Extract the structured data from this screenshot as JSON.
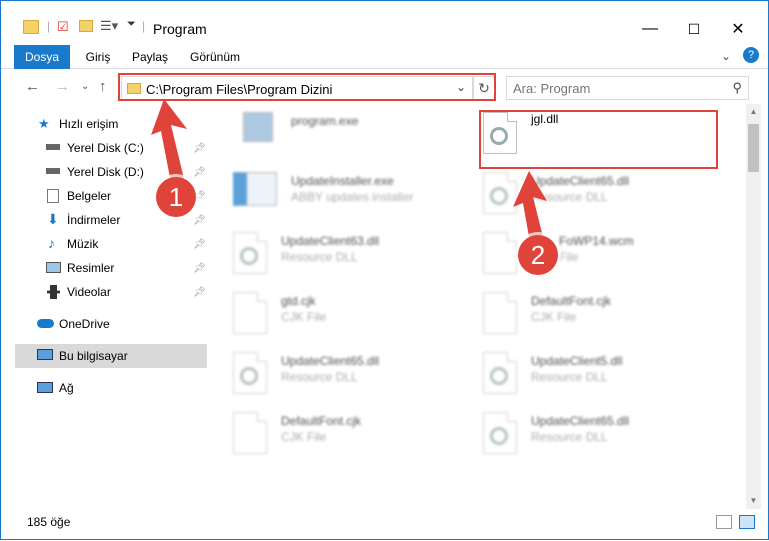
{
  "window": {
    "title": "Program",
    "controls": {
      "minimize": "—",
      "maximize": "☐",
      "close": "✕"
    }
  },
  "ribbon": {
    "tabs": [
      {
        "label": "Dosya"
      },
      {
        "label": "Giriş"
      },
      {
        "label": "Paylaş"
      },
      {
        "label": "Görünüm"
      }
    ],
    "help_icon": "?"
  },
  "address": {
    "path": "C:\\Program Files\\Program Dizini",
    "search_placeholder": "Ara: Program"
  },
  "sidebar": {
    "items": [
      {
        "label": "Hızlı erişim",
        "icon": "star-icon"
      },
      {
        "label": "Yerel Disk (C:)",
        "icon": "drive-icon"
      },
      {
        "label": "Yerel Disk (D:)",
        "icon": "drive-icon"
      },
      {
        "label": "Belgeler",
        "icon": "documents-icon"
      },
      {
        "label": "İndirmeler",
        "icon": "download-icon"
      },
      {
        "label": "Müzik",
        "icon": "music-icon"
      },
      {
        "label": "Resimler",
        "icon": "pictures-icon"
      },
      {
        "label": "Videolar",
        "icon": "videos-icon"
      },
      {
        "label": "OneDrive",
        "icon": "cloud-icon"
      },
      {
        "label": "Bu bilgisayar",
        "icon": "computer-icon"
      },
      {
        "label": "Ağ",
        "icon": "network-icon"
      }
    ]
  },
  "files": [
    {
      "name": "program.exe",
      "desc": ""
    },
    {
      "name": "jgl.dll",
      "desc": ""
    },
    {
      "name": "UpdateInstaller.exe",
      "desc": "ABBY updates installer"
    },
    {
      "name": "UpdateClient65.dll",
      "desc": "Resource DLL"
    },
    {
      "name": "UpdateClient63.dll",
      "desc": "Resource DLL"
    },
    {
      "name": "FoWP14.wcm",
      "desc": "File"
    },
    {
      "name": "gtd.cjk",
      "desc": "CJK File"
    },
    {
      "name": "DefaultFont.cjk",
      "desc": "CJK File"
    },
    {
      "name": "UpdateClient65.dll",
      "desc": "Resource DLL"
    },
    {
      "name": "UpdateClient5.dll",
      "desc": "Resource DLL"
    },
    {
      "name": "DefaultFont.cjk",
      "desc": "CJK File"
    },
    {
      "name": "UpdateClient65.dll",
      "desc": "Resource DLL"
    }
  ],
  "status": {
    "count": "185 öğe"
  },
  "annotations": [
    {
      "label": "1"
    },
    {
      "label": "2"
    }
  ],
  "colors": {
    "accent": "#1979ca",
    "highlight": "#e0433a"
  }
}
